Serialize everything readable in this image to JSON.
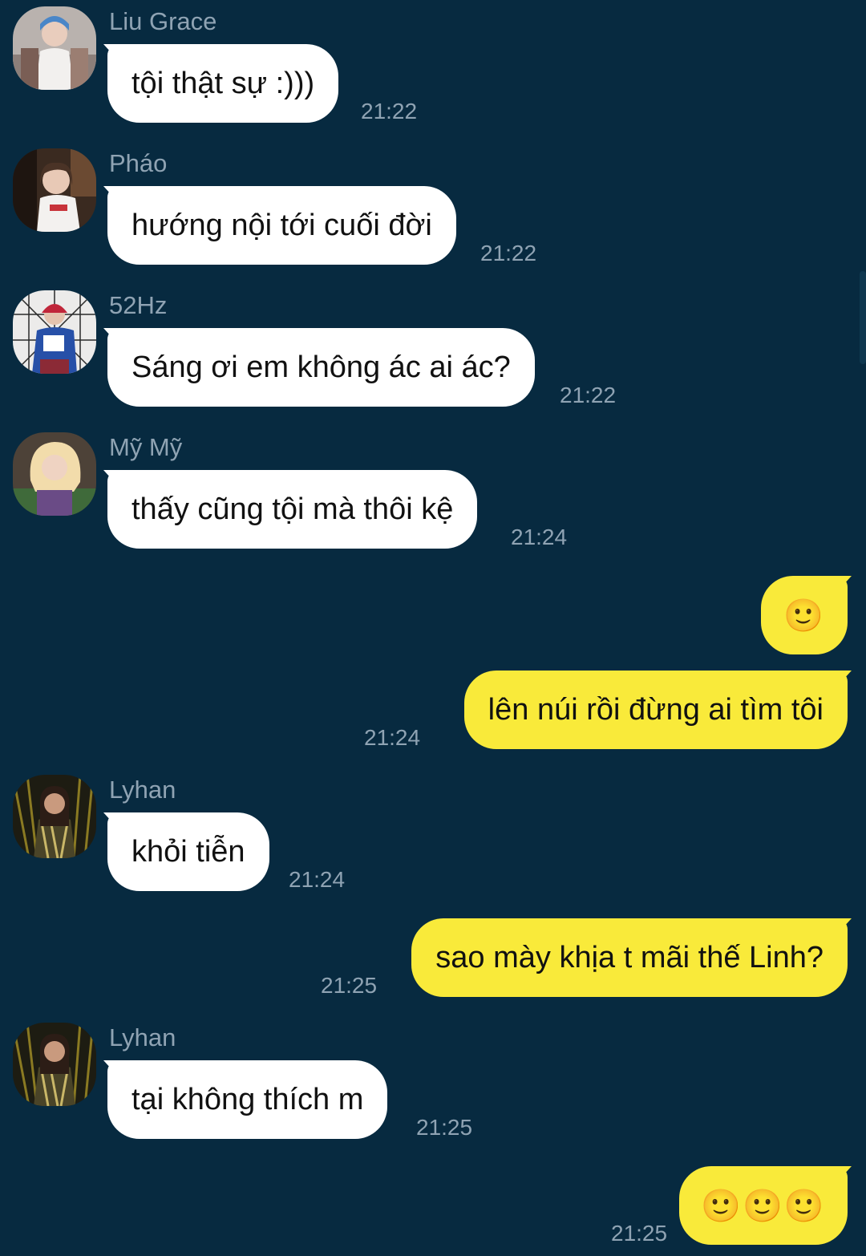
{
  "messages": [
    {
      "sender": "Liu Grace",
      "text": "tội thật sự :)))",
      "time": "21:22",
      "avatar": "avatar-liu-grace"
    },
    {
      "sender": "Pháo",
      "text": "hướng nội tới cuối đời",
      "time": "21:22",
      "avatar": "avatar-phao"
    },
    {
      "sender": "52Hz",
      "text": "Sáng ơi em không ác ai ác?",
      "time": "21:22",
      "avatar": "avatar-52hz"
    },
    {
      "sender": "Mỹ Mỹ",
      "text": "thấy cũng tội mà thôi kệ",
      "time": "21:24",
      "avatar": "avatar-my-my"
    },
    {
      "outgoing": true,
      "text": "🙂"
    },
    {
      "outgoing": true,
      "text": "lên núi rồi đừng ai tìm tôi",
      "time": "21:24"
    },
    {
      "sender": "Lyhan",
      "text": "khỏi tiễn",
      "time": "21:24",
      "avatar": "avatar-lyhan"
    },
    {
      "outgoing": true,
      "text": "sao mày khịa t mãi thế Linh?",
      "time": "21:25"
    },
    {
      "sender": "Lyhan",
      "text": "tại không thích m",
      "time": "21:25",
      "avatar": "avatar-lyhan"
    },
    {
      "outgoing": true,
      "text": "🙂🙂🙂",
      "time": "21:25"
    }
  ],
  "colors": {
    "background": "#072a40",
    "incoming_bubble": "#ffffff",
    "outgoing_bubble": "#f9ea3a",
    "meta_text": "#8fa3b3"
  }
}
